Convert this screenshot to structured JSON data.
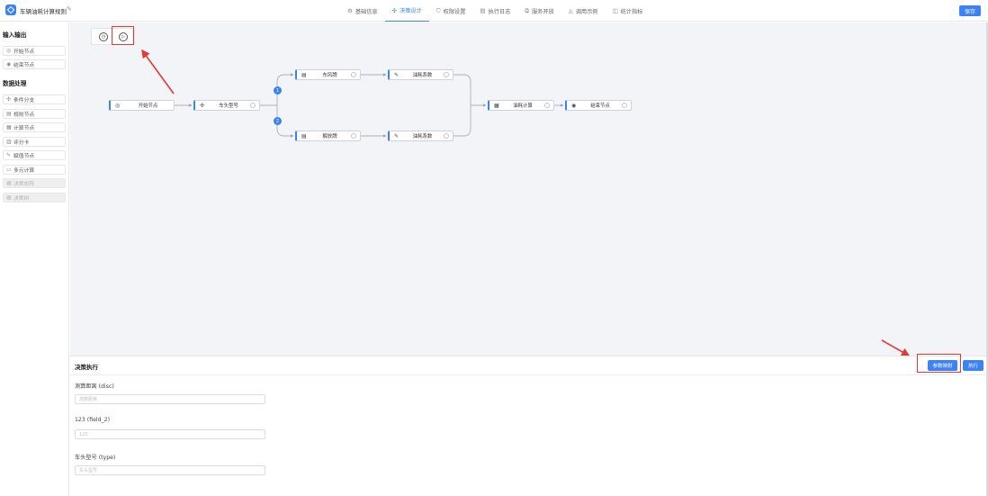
{
  "header": {
    "app_title": "车辆油耗计算规则",
    "save_label": "保存",
    "tabs": [
      {
        "label": "基础信息",
        "icon": "info-icon",
        "active": false
      },
      {
        "label": "决策设计",
        "icon": "design-icon",
        "active": true
      },
      {
        "label": "权限设置",
        "icon": "lock-icon",
        "active": false
      },
      {
        "label": "执行日志",
        "icon": "log-icon",
        "active": false
      },
      {
        "label": "服务开放",
        "icon": "share-icon",
        "active": false
      },
      {
        "label": "调用示例",
        "icon": "example-icon",
        "active": false
      },
      {
        "label": "统计指标",
        "icon": "chart-icon",
        "active": false
      }
    ]
  },
  "sidebar": {
    "sections": [
      {
        "title": "输入输出",
        "items": [
          {
            "label": "开始节点",
            "icon": "circle-dot-icon",
            "disabled": false
          },
          {
            "label": "结束节点",
            "icon": "circle-stop-icon",
            "disabled": false
          }
        ]
      },
      {
        "title": "数据处理",
        "items": [
          {
            "label": "条件分支",
            "icon": "branch-icon",
            "disabled": false
          },
          {
            "label": "规则节点",
            "icon": "rule-icon",
            "disabled": false
          },
          {
            "label": "计算节点",
            "icon": "calc-icon",
            "disabled": false
          },
          {
            "label": "评分卡",
            "icon": "scorecard-icon",
            "disabled": false
          },
          {
            "label": "赋值节点",
            "icon": "assign-icon",
            "disabled": false
          },
          {
            "label": "多元计算",
            "icon": "table-icon",
            "disabled": false
          },
          {
            "label": "决策矩阵",
            "icon": "matrix-icon",
            "disabled": true
          },
          {
            "label": "决策树",
            "icon": "tree-icon",
            "disabled": true
          }
        ]
      }
    ]
  },
  "canvas": {
    "toolbar": [
      {
        "name": "history-icon",
        "glyph": "◷"
      },
      {
        "name": "run-icon",
        "glyph": "▷"
      }
    ],
    "nodes": [
      {
        "id": "start",
        "label": "开始节点",
        "icon": "circle-dot-icon"
      },
      {
        "id": "branch",
        "label": "车头型号",
        "icon": "branch-icon"
      },
      {
        "id": "rule1",
        "label": "东风牌",
        "icon": "rule-icon"
      },
      {
        "id": "assign1",
        "label": "油耗系数",
        "icon": "assign-icon"
      },
      {
        "id": "rule2",
        "label": "解放牌",
        "icon": "rule-icon"
      },
      {
        "id": "assign2",
        "label": "油耗系数",
        "icon": "assign-icon"
      },
      {
        "id": "calc",
        "label": "油耗计算",
        "icon": "calc-icon"
      },
      {
        "id": "end",
        "label": "结束节点",
        "icon": "circle-stop-icon"
      }
    ],
    "branch_badges": [
      "1",
      "2"
    ]
  },
  "panel": {
    "title": "决策执行",
    "param_map_label": "参数映射",
    "run_label": "执行",
    "fields": [
      {
        "label": "测算距离 (disc)",
        "placeholder": "测算距离"
      },
      {
        "label": "123 (field_2)",
        "placeholder": "123"
      },
      {
        "label": "车头型号 (type)",
        "placeholder": "车头型号"
      }
    ]
  },
  "colors": {
    "accent": "#3b82f6",
    "highlight": "#e53935",
    "canvas_bg": "#f3f4f7"
  }
}
